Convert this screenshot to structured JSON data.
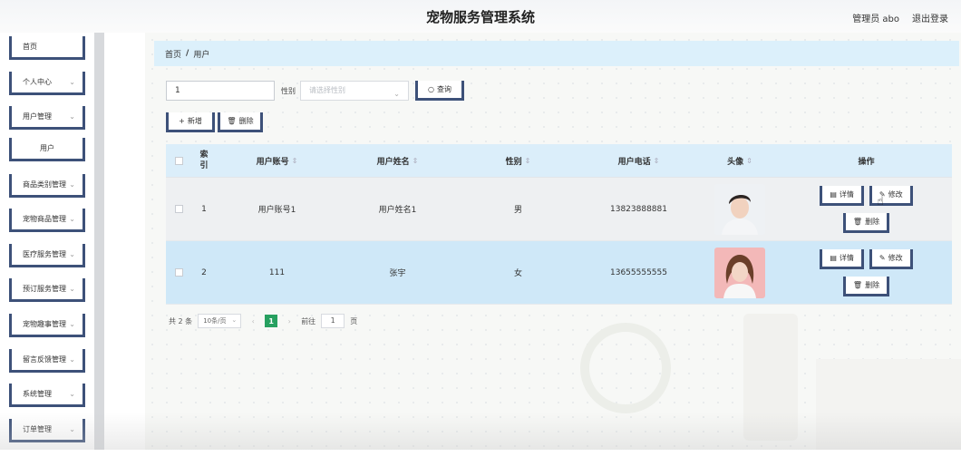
{
  "header": {
    "title": "宠物服务管理系统",
    "user": "管理员 abo",
    "logout": "退出登录"
  },
  "sidebar": {
    "items": [
      {
        "label": "首页",
        "chevron": false
      },
      {
        "label": "个人中心",
        "chevron": true
      },
      {
        "label": "用户管理",
        "chevron": true
      },
      {
        "label": "用户",
        "chevron": false,
        "sub": true
      },
      {
        "label": "商品类别管理",
        "chevron": true
      },
      {
        "label": "宠物商品管理",
        "chevron": true
      },
      {
        "label": "医疗服务管理",
        "chevron": true
      },
      {
        "label": "预订服务管理",
        "chevron": true
      },
      {
        "label": "宠物趣事管理",
        "chevron": true
      },
      {
        "label": "留言反馈管理",
        "chevron": true
      },
      {
        "label": "系统管理",
        "chevron": true
      },
      {
        "label": "订单管理",
        "chevron": true
      }
    ]
  },
  "breadcrumb": {
    "home": "首页",
    "separator": "/",
    "current": "用户"
  },
  "search": {
    "value": "1",
    "gender_label": "性别",
    "gender_placeholder": "请选择性别",
    "search_button": "查询",
    "add_button": "新增",
    "delete_button": "删除"
  },
  "table": {
    "headers": {
      "index_line1": "索",
      "index_line2": "引",
      "account": "用户账号",
      "name": "用户姓名",
      "gender": "性别",
      "phone": "用户电话",
      "avatar": "头像",
      "actions": "操作"
    },
    "rows": [
      {
        "index": "1",
        "account": "用户账号1",
        "name": "用户姓名1",
        "gender": "男",
        "phone": "13823888881"
      },
      {
        "index": "2",
        "account": "111",
        "name": "张宇",
        "gender": "女",
        "phone": "13655555555"
      }
    ],
    "actions": {
      "detail": "详情",
      "edit": "修改",
      "delete": "删除"
    }
  },
  "pager": {
    "total": "共 2 条",
    "page_size": "10条/页",
    "current_page": "1",
    "goto_label": "前往",
    "goto_value": "1",
    "page_unit": "页"
  },
  "colors": {
    "accent": "#3d5179",
    "header_bg": "#dbeefa",
    "row_highlight": "#cfe8f8",
    "page_active": "#27a060"
  }
}
